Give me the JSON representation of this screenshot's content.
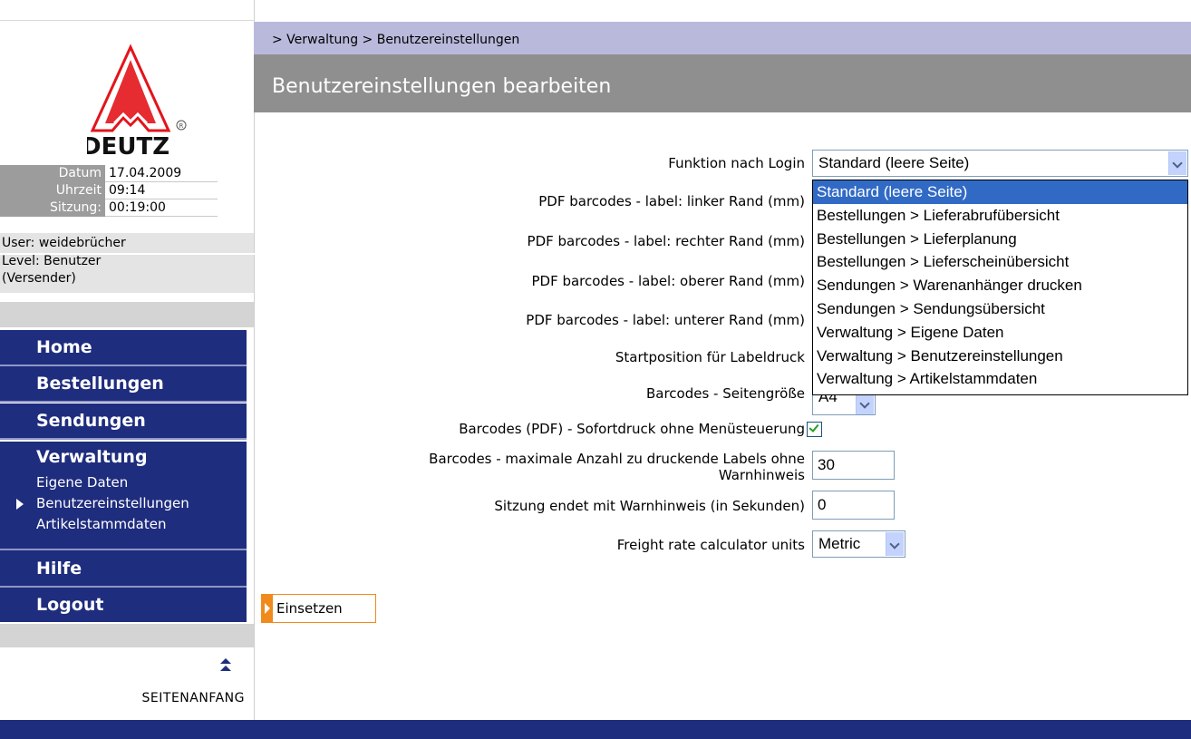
{
  "sidebar": {
    "logo_text": "DEUTZ",
    "info": [
      {
        "label": "Datum",
        "value": "17.04.2009"
      },
      {
        "label": "Uhrzeit",
        "value": "09:14"
      },
      {
        "label": "Sitzung:",
        "value": "00:19:00"
      }
    ],
    "user_line": "User: weidebrücher",
    "level_line1": "Level:  Benutzer",
    "level_line2": "(Versender)",
    "nav": {
      "home": "Home",
      "bestellungen": "Bestellungen",
      "sendungen": "Sendungen",
      "verwaltung": "Verwaltung",
      "verwaltung_sub": [
        "Eigene Daten",
        "Benutzereinstellungen",
        "Artikelstammdaten"
      ],
      "hilfe": "Hilfe",
      "logout": "Logout"
    },
    "top_link": "SEITENANFANG"
  },
  "breadcrumb": "> Verwaltung > Benutzereinstellungen",
  "page_title": "Benutzereinstellungen bearbeiten",
  "form": {
    "funktion_label": "Funktion nach Login",
    "funktion_value": "Standard (leere Seite)",
    "funktion_options": [
      "Standard (leere Seite)",
      "Bestellungen > Lieferabrufübersicht",
      "Bestellungen > Lieferplanung",
      "Bestellungen > Lieferscheinübersicht",
      "Sendungen > Warenanhänger drucken",
      "Sendungen > Sendungsübersicht",
      "Verwaltung > Eigene Daten",
      "Verwaltung > Benutzereinstellungen",
      "Verwaltung > Artikelstammdaten"
    ],
    "linker_label": "PDF barcodes - label: linker Rand (mm)",
    "rechter_label": "PDF barcodes - label: rechter Rand (mm)",
    "oberer_label": "PDF barcodes - label: oberer Rand (mm)",
    "unterer_label": "PDF barcodes - label: unterer Rand (mm)",
    "startpos_label": "Startposition für Labeldruck",
    "seitengroesse_label": "Barcodes - Seitengröße",
    "seitengroesse_value": "A4",
    "sofortdruck_label": "Barcodes (PDF) - Sofortdruck ohne Menüsteuerung",
    "sofortdruck_checked": true,
    "maxlabels_label_line1": "Barcodes - maximale Anzahl zu druckende Labels ohne",
    "maxlabels_label_line2": "Warnhinweis",
    "maxlabels_value": "30",
    "sitzung_label": "Sitzung endet mit Warnhinweis (in Sekunden)",
    "sitzung_value": "0",
    "freight_label": "Freight rate calculator units",
    "freight_value": "Metric",
    "submit_label": "Einsetzen"
  },
  "colors": {
    "nav_bg": "#1f2d7e",
    "breadcrumb_bg": "#b8b9db",
    "title_bg": "#8f8f8f",
    "accent_orange": "#f08a1c",
    "logo_red": "#e3141b"
  }
}
